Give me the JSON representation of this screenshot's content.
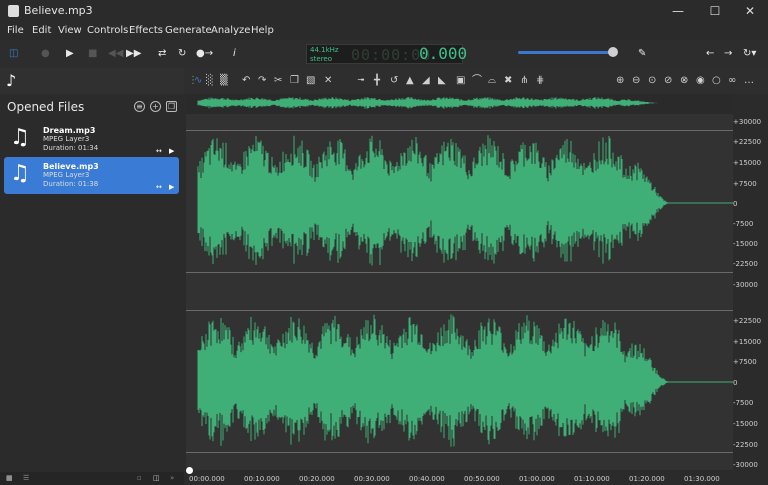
{
  "window": {
    "title": "Believe.mp3",
    "minimize": "—",
    "maximize": "☐",
    "close": "✕"
  },
  "menu": [
    "File",
    "Edit",
    "View",
    "Controls",
    "Effects",
    "Generate",
    "Analyze",
    "Help"
  ],
  "transport": {
    "sample_rate": "44.1kHz",
    "channels": "stereo",
    "time_ghost": "00:00:00",
    "time_value": "0.000"
  },
  "sidebar": {
    "title": "Opened Files",
    "files": [
      {
        "name": "Dream.mp3",
        "format": "MPEG Layer3",
        "duration": "Duration: 01:34",
        "active": false
      },
      {
        "name": "Believe.mp3",
        "format": "MPEG Layer3",
        "duration": "Duration: 01:38",
        "active": true
      }
    ]
  },
  "amplitude_labels_top": [
    "+30000",
    "+22500",
    "+15000",
    "+7500",
    "0",
    "-7500",
    "-15000",
    "-22500",
    "-30000"
  ],
  "amplitude_labels_bottom": [
    "+22500",
    "+15000",
    "+7500",
    "0",
    "-7500",
    "-15000",
    "-22500",
    "-30000"
  ],
  "time_labels": [
    "00:00.000",
    "00:10.000",
    "00:20.000",
    "00:30.000",
    "00:40.000",
    "00:50.000",
    "01:00.000",
    "01:10.000",
    "01:20.000",
    "01:30.000"
  ],
  "colors": {
    "accent": "#3a7bd5",
    "waveform": "#3fae77",
    "display": "#3ec18b"
  }
}
